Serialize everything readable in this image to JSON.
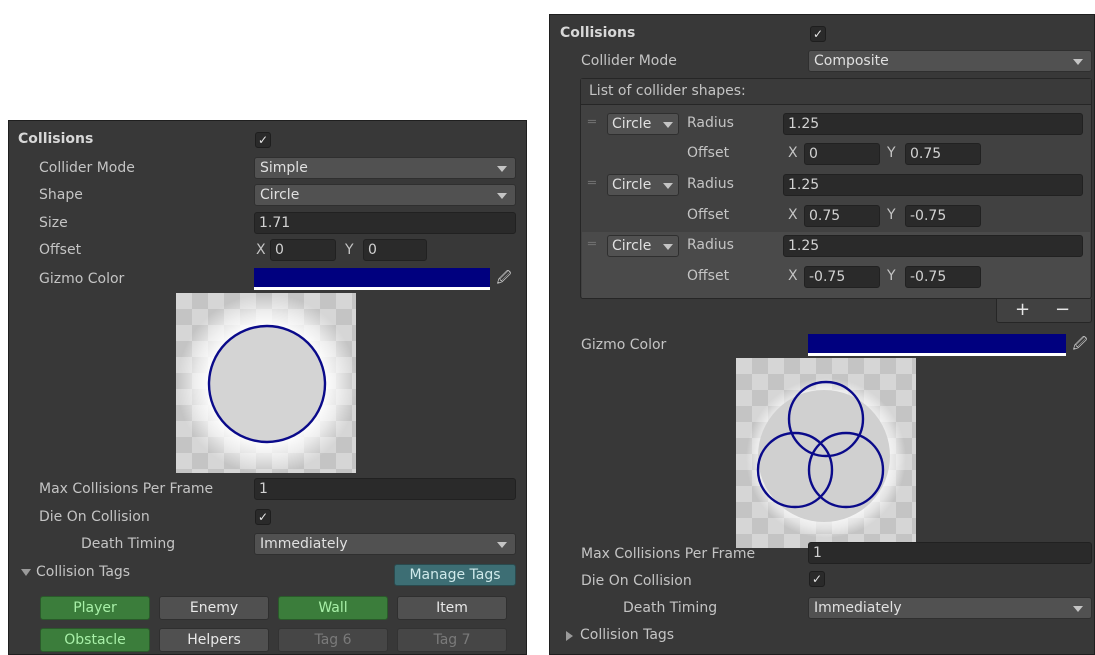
{
  "colors": {
    "gizmo": "#00007f",
    "panel": "#383838",
    "tag_on": "#3b7d3b"
  },
  "left": {
    "header": {
      "label": "Collisions",
      "checked": "✓"
    },
    "collider_mode": {
      "label": "Collider Mode",
      "value": "Simple"
    },
    "shape": {
      "label": "Shape",
      "value": "Circle"
    },
    "size": {
      "label": "Size",
      "value": "1.71"
    },
    "offset": {
      "label": "Offset",
      "x_label": "X",
      "x": "0",
      "y_label": "Y",
      "y": "0"
    },
    "gizmo_color": {
      "label": "Gizmo Color",
      "icon": "eyedropper-icon"
    },
    "max_collisions": {
      "label": "Max Collisions Per Frame",
      "value": "1"
    },
    "die_on_collision": {
      "label": "Die On Collision",
      "checked": "✓"
    },
    "death_timing": {
      "label": "Death Timing",
      "value": "Immediately"
    },
    "collision_tags": {
      "label": "Collision Tags",
      "expanded": true,
      "manage_label": "Manage Tags",
      "tags": [
        {
          "label": "Player",
          "state": "on"
        },
        {
          "label": "Enemy",
          "state": "off"
        },
        {
          "label": "Wall",
          "state": "on"
        },
        {
          "label": "Item",
          "state": "off"
        },
        {
          "label": "Obstacle",
          "state": "on"
        },
        {
          "label": "Helpers",
          "state": "off"
        },
        {
          "label": "Tag 6",
          "state": "dim"
        },
        {
          "label": "Tag 7",
          "state": "dim"
        }
      ]
    }
  },
  "right": {
    "header": {
      "label": "Collisions",
      "checked": "✓"
    },
    "collider_mode": {
      "label": "Collider Mode",
      "value": "Composite"
    },
    "shapes_list": {
      "title": "List of collider shapes:",
      "items": [
        {
          "type": "Circle",
          "radius_label": "Radius",
          "radius": "1.25",
          "offset_label": "Offset",
          "x_label": "X",
          "x": "0",
          "y_label": "Y",
          "y": "0.75"
        },
        {
          "type": "Circle",
          "radius_label": "Radius",
          "radius": "1.25",
          "offset_label": "Offset",
          "x_label": "X",
          "x": "0.75",
          "y_label": "Y",
          "y": "-0.75"
        },
        {
          "type": "Circle",
          "radius_label": "Radius",
          "radius": "1.25",
          "offset_label": "Offset",
          "x_label": "X",
          "x": "-0.75",
          "y_label": "Y",
          "y": "-0.75"
        }
      ],
      "add_label": "+",
      "remove_label": "−"
    },
    "gizmo_color": {
      "label": "Gizmo Color",
      "icon": "eyedropper-icon"
    },
    "max_collisions": {
      "label": "Max Collisions Per Frame",
      "value": "1"
    },
    "die_on_collision": {
      "label": "Die On Collision",
      "checked": "✓"
    },
    "death_timing": {
      "label": "Death Timing",
      "value": "Immediately"
    },
    "collision_tags": {
      "label": "Collision Tags",
      "expanded": false
    }
  }
}
